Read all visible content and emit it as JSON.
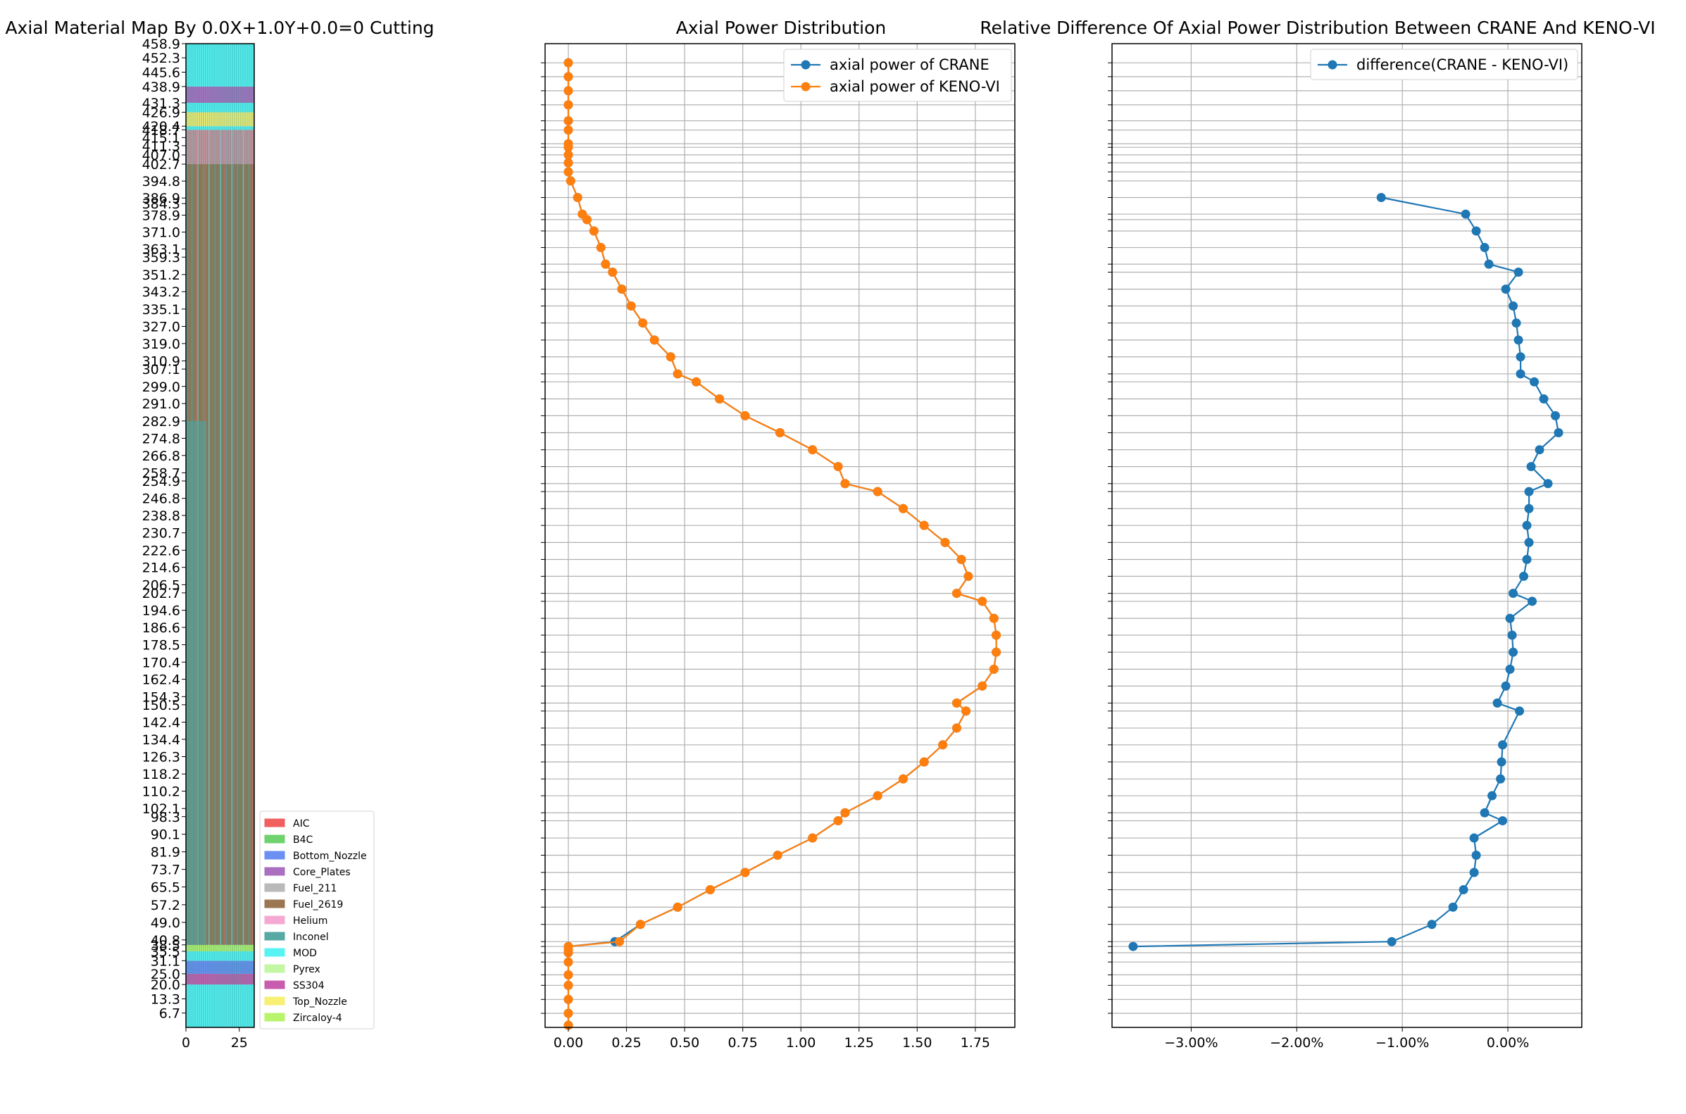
{
  "colors": {
    "crane": "#1f77b4",
    "keno": "#ff7f0e",
    "grid": "#b0b0b0",
    "materials": {
      "AIC": "#f25f5f",
      "B4C": "#6fd26f",
      "Bottom_Nozzle": "#6b8ff2",
      "Core_Plates": "#ab6fc0",
      "Fuel_211": "#b9b9b9",
      "Fuel_2619": "#9b7652",
      "Helium": "#f4a9d3",
      "Inconel": "#56a9a4",
      "MOD": "#58f4f4",
      "Pyrex": "#c3f7a4",
      "SS304": "#c85cae",
      "Top_Nozzle": "#f7f072",
      "Zircaloy-4": "#b8f46c"
    }
  },
  "chart_data": [
    {
      "type": "heatmap",
      "title": "Axial Material Map By 0.0X+1.0Y+0.0=0 Cutting",
      "x_ticks": [
        "0",
        "25"
      ],
      "xlim": [
        0,
        32
      ],
      "ylim": [
        0,
        458.9
      ],
      "y_ticks": [
        "6.7",
        "13.3",
        "20.0",
        "25.0",
        "31.1",
        "35.5",
        "38.5",
        "40.8",
        "49.0",
        "57.2",
        "65.5",
        "73.7",
        "81.9",
        "90.1",
        "98.3",
        "102.1",
        "110.2",
        "118.2",
        "126.3",
        "134.4",
        "142.4",
        "150.5",
        "154.3",
        "162.4",
        "170.4",
        "178.5",
        "186.6",
        "194.6",
        "202.7",
        "206.5",
        "214.6",
        "222.6",
        "230.7",
        "238.8",
        "246.8",
        "254.9",
        "258.7",
        "266.8",
        "274.8",
        "282.9",
        "291.0",
        "299.0",
        "307.1",
        "310.9",
        "319.0",
        "327.0",
        "335.1",
        "343.2",
        "351.2",
        "359.3",
        "363.1",
        "371.0",
        "378.9",
        "384.3",
        "386.9",
        "394.8",
        "402.7",
        "407.0",
        "411.3",
        "415.1",
        "418.7",
        "420.4",
        "426.9",
        "431.3",
        "438.9",
        "445.6",
        "452.3",
        "458.9"
      ],
      "legend": [
        "AIC",
        "B4C",
        "Bottom_Nozzle",
        "Core_Plates",
        "Fuel_211",
        "Fuel_2619",
        "Helium",
        "Inconel",
        "MOD",
        "Pyrex",
        "SS304",
        "Top_Nozzle",
        "Zircaloy-4"
      ],
      "legend_position": "lower-right"
    },
    {
      "type": "line",
      "title": "Axial Power Distribution",
      "xlim": [
        -0.1,
        1.92
      ],
      "x_ticks": [
        "0.00",
        "0.25",
        "0.50",
        "0.75",
        "1.00",
        "1.25",
        "1.50",
        "1.75"
      ],
      "grid": true,
      "legend_position": "top-right",
      "series": [
        {
          "name": "axial power of CRANE",
          "x": [
            0,
            0,
            0,
            0,
            0,
            0,
            0,
            0,
            0,
            0.2,
            0.31,
            0.47,
            0.61,
            0.76,
            0.9,
            1.05,
            1.16,
            1.19,
            1.33,
            1.44,
            1.53,
            1.61,
            1.67,
            1.71,
            1.67,
            1.78,
            1.83,
            1.84,
            1.84,
            1.83,
            1.78,
            1.67,
            1.72,
            1.69,
            1.62,
            1.53,
            1.44,
            1.33,
            1.19,
            1.16,
            1.05,
            0.91,
            0.76,
            0.65,
            0.55,
            0.47,
            0.44,
            0.37,
            0.32,
            0.27,
            0.23,
            0.19,
            0.16,
            0.14,
            0.11,
            0.08,
            0.06,
            0.04,
            0.01,
            0,
            0,
            0,
            0,
            0,
            0,
            0,
            0,
            0,
            0,
            0
          ],
          "y": [
            1,
            6.7,
            13.3,
            20.0,
            25.0,
            31.1,
            35.5,
            37,
            38.5,
            40.8,
            49.0,
            57.2,
            65.5,
            73.7,
            81.9,
            90.1,
            98.3,
            102.1,
            110.2,
            118.2,
            126.3,
            134.4,
            142.4,
            150.5,
            154.3,
            162.4,
            170.4,
            178.5,
            186.6,
            194.6,
            202.7,
            206.5,
            214.6,
            222.6,
            230.7,
            238.8,
            246.8,
            254.9,
            258.7,
            266.8,
            274.8,
            282.9,
            291.0,
            299.0,
            307.1,
            310.9,
            319.0,
            327.0,
            335.1,
            343.2,
            351.2,
            359.3,
            363.1,
            371.0,
            378.9,
            384.3,
            386.9,
            394.8,
            402.7,
            407.0,
            411.3,
            415.1,
            418.7,
            420.4,
            426.9,
            431.3,
            438.9,
            445.6,
            452.3,
            458.9
          ]
        },
        {
          "name": "axial power of KENO-VI",
          "x": [
            0,
            0,
            0,
            0,
            0,
            0,
            0,
            0,
            0,
            0.22,
            0.31,
            0.47,
            0.61,
            0.76,
            0.9,
            1.05,
            1.16,
            1.19,
            1.33,
            1.44,
            1.53,
            1.61,
            1.67,
            1.71,
            1.67,
            1.78,
            1.83,
            1.84,
            1.84,
            1.83,
            1.78,
            1.67,
            1.72,
            1.69,
            1.62,
            1.53,
            1.44,
            1.33,
            1.19,
            1.16,
            1.05,
            0.91,
            0.76,
            0.65,
            0.55,
            0.47,
            0.44,
            0.37,
            0.32,
            0.27,
            0.23,
            0.19,
            0.16,
            0.14,
            0.11,
            0.08,
            0.06,
            0.04,
            0.01,
            0,
            0,
            0,
            0,
            0,
            0,
            0,
            0,
            0,
            0,
            0
          ],
          "y": [
            1,
            6.7,
            13.3,
            20.0,
            25.0,
            31.1,
            35.5,
            37,
            38.5,
            40.8,
            49.0,
            57.2,
            65.5,
            73.7,
            81.9,
            90.1,
            98.3,
            102.1,
            110.2,
            118.2,
            126.3,
            134.4,
            142.4,
            150.5,
            154.3,
            162.4,
            170.4,
            178.5,
            186.6,
            194.6,
            202.7,
            206.5,
            214.6,
            222.6,
            230.7,
            238.8,
            246.8,
            254.9,
            258.7,
            266.8,
            274.8,
            282.9,
            291.0,
            299.0,
            307.1,
            310.9,
            319.0,
            327.0,
            335.1,
            343.2,
            351.2,
            359.3,
            363.1,
            371.0,
            378.9,
            384.3,
            386.9,
            394.8,
            402.7,
            407.0,
            411.3,
            415.1,
            418.7,
            420.4,
            426.9,
            431.3,
            438.9,
            445.6,
            452.3,
            458.9
          ]
        }
      ]
    },
    {
      "type": "line",
      "title": "Relative Difference Of Axial Power Distribution Between CRANE And KENO-VI",
      "xlim": [
        -3.75,
        0.7
      ],
      "x_ticks": [
        -3,
        -2,
        -1,
        0
      ],
      "x_tick_labels": [
        "−3.00%",
        "−2.00%",
        "−1.00%",
        "0.00%"
      ],
      "grid": true,
      "legend_position": "top-right",
      "series": [
        {
          "name": "difference(CRANE - KENO-VI)",
          "x": [
            -3.55,
            -1.1,
            -0.72,
            -0.52,
            -0.42,
            -0.32,
            -0.3,
            -0.32,
            -0.05,
            -0.22,
            -0.15,
            -0.07,
            -0.06,
            -0.05,
            0.11,
            -0.1,
            -0.02,
            0.02,
            0.05,
            0.04,
            0.02,
            0.23,
            0.05,
            0.15,
            0.18,
            0.2,
            0.18,
            0.2,
            0.2,
            0.38,
            0.22,
            0.3,
            0.48,
            0.45,
            0.34,
            0.25,
            0.12,
            0.12,
            0.1,
            0.08,
            0.05,
            -0.02,
            0.1,
            -0.18,
            -0.22,
            -0.3,
            -0.4,
            -1.2
          ],
          "y": [
            38.5,
            40.8,
            49.0,
            57.2,
            65.5,
            73.7,
            81.9,
            90.1,
            98.3,
            102.1,
            110.2,
            118.2,
            126.3,
            134.4,
            150.5,
            154.3,
            162.4,
            170.4,
            178.5,
            186.6,
            194.6,
            202.7,
            206.5,
            214.6,
            222.6,
            230.7,
            238.8,
            246.8,
            254.9,
            258.7,
            266.8,
            274.8,
            282.9,
            291.0,
            299.0,
            307.1,
            310.9,
            319.0,
            327.0,
            335.1,
            343.2,
            351.2,
            359.3,
            363.1,
            371.0,
            378.9,
            386.9,
            394.8
          ]
        }
      ]
    }
  ]
}
